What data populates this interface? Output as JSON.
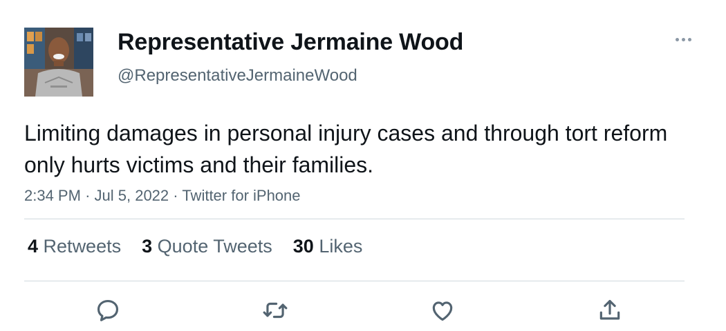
{
  "tweet": {
    "author": {
      "name": "Representative Jermaine Wood",
      "handle": "@RepresentativeJermaineWood",
      "avatar_icon": "profile-photo"
    },
    "text": "Limiting damages in personal injury cases and through tort reform only hurts victims and their families.",
    "time": "2:34 PM",
    "date": "Jul 5, 2022",
    "source": "Twitter for iPhone",
    "separator": "·",
    "stats": {
      "retweets": {
        "count": "4",
        "label": "Retweets"
      },
      "quote_tweets": {
        "count": "3",
        "label": "Quote Tweets"
      },
      "likes": {
        "count": "30",
        "label": "Likes"
      }
    },
    "actions": [
      "reply-icon",
      "retweet-icon",
      "like-icon",
      "share-icon"
    ],
    "more_icon": "more-options-icon"
  },
  "colors": {
    "text_primary": "#0f1419",
    "text_secondary": "#536471",
    "divider": "#cfd9de",
    "background": "#ffffff"
  }
}
